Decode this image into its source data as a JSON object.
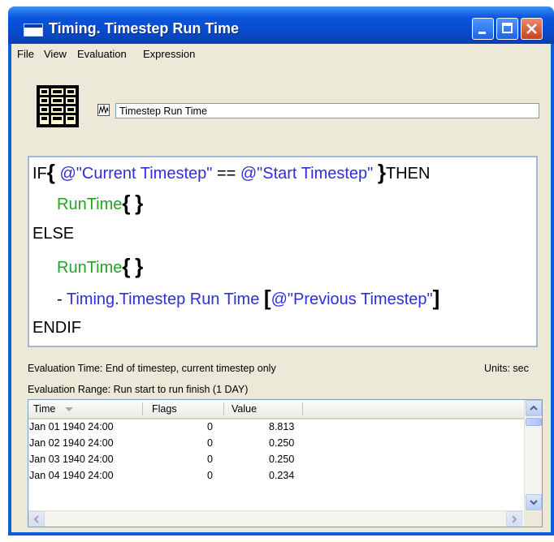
{
  "window": {
    "title": "Timing. Timestep Run Time"
  },
  "menu": [
    "File",
    "View",
    "Evaluation",
    "Expression"
  ],
  "name_field": {
    "value": "Timestep Run Time"
  },
  "expression": {
    "l1_if": "IF",
    "l1_a": "@\"Current Timestep\"",
    "l1_op": "==",
    "l1_b": "@\"Start Timestep\"",
    "l1_then": "THEN",
    "l2_fn": "RunTime",
    "l3_else": "ELSE",
    "l4_fn": "RunTime",
    "l5_minus": "- ",
    "l5_slot": "Timing.Timestep Run Time",
    "l5_arg": "@\"Previous Timestep\"",
    "l6_endif": "ENDIF"
  },
  "info": {
    "evaluation_time": "Evaluation Time: End of timestep, current timestep only",
    "units": "Units: sec",
    "evaluation_range": "Evaluation Range: Run start to run finish    (1 DAY)"
  },
  "table": {
    "columns": [
      "Time",
      "Flags",
      "Value"
    ],
    "rows": [
      {
        "time": "Jan 01 1940  24:00",
        "flags": "0",
        "value": "8.813"
      },
      {
        "time": "Jan 02 1940  24:00",
        "flags": "0",
        "value": "0.250"
      },
      {
        "time": "Jan 03 1940  24:00",
        "flags": "0",
        "value": "0.250"
      },
      {
        "time": "Jan 04 1940  24:00",
        "flags": "0",
        "value": "0.234"
      }
    ]
  },
  "colors": {
    "keyword": "#000000",
    "slot": "#2f2fd8",
    "function": "#22a322",
    "titlebar": "#0a55dc"
  }
}
